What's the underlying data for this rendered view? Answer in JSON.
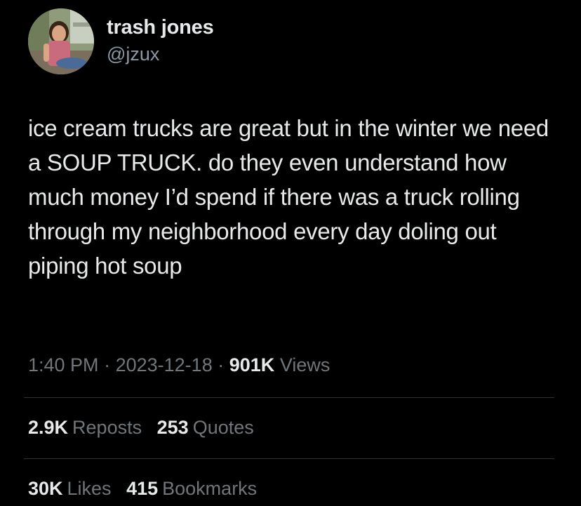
{
  "author": {
    "display_name": "trash jones",
    "handle": "@jzux",
    "avatar_icon": "profile-photo"
  },
  "tweet": {
    "text": "ice cream trucks are great but in the winter we need a SOUP TRUCK. do they even understand how much money I’d spend if there was a truck rolling through my neighborhood every day doling out piping hot soup",
    "time": "1:40 PM",
    "separator": "·",
    "date": "2023-12-18",
    "views_count": "901K",
    "views_label": "Views"
  },
  "engagement": {
    "reposts_count": "2.9K",
    "reposts_label": "Reposts",
    "quotes_count": "253",
    "quotes_label": "Quotes",
    "likes_count": "30K",
    "likes_label": "Likes",
    "bookmarks_count": "415",
    "bookmarks_label": "Bookmarks"
  },
  "colors": {
    "background": "#000000",
    "primary_text": "#e7e9ea",
    "secondary_text": "#71767b",
    "divider": "#2f3336"
  }
}
